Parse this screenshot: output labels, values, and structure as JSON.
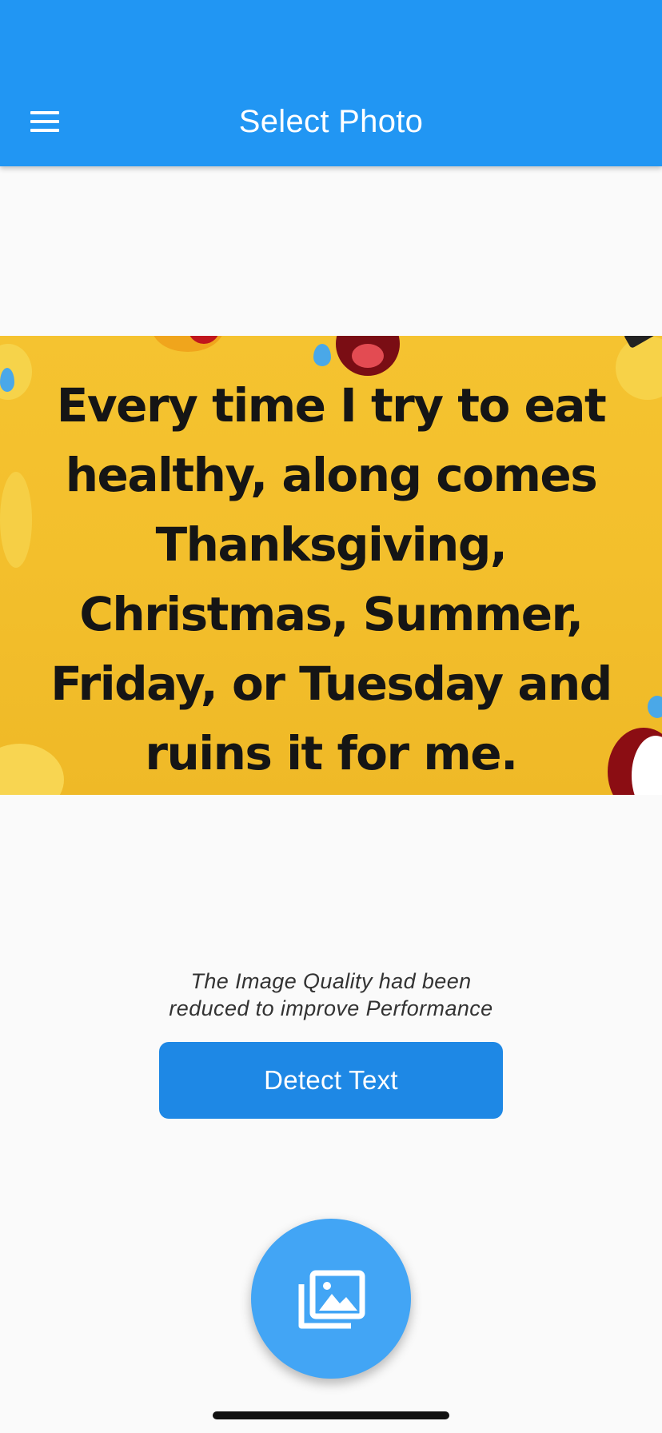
{
  "appbar": {
    "title": "Select Photo",
    "menu_icon": "hamburger-menu-icon",
    "color": "#2196f3"
  },
  "selected_image": {
    "lines": [
      "Every time I try to eat",
      "healthy, along comes",
      "Thanksgiving,",
      "Christmas, Summer,",
      "Friday, or Tuesday and",
      "ruins it for me."
    ]
  },
  "notice": {
    "line1": "The Image Quality had been",
    "line2": "reduced to improve Performance"
  },
  "detect_button": {
    "label": "Detect Text",
    "color": "#1e88e5"
  },
  "fab": {
    "icon": "photo-library-icon",
    "color": "#42a5f5"
  }
}
